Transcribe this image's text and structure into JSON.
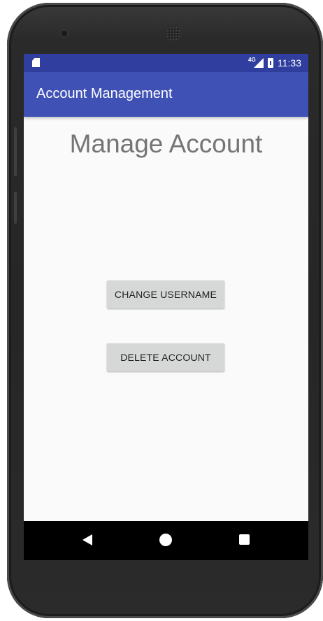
{
  "status_bar": {
    "network_label": "4G",
    "time": "11:33",
    "icons": [
      "sd-card-icon",
      "signal-icon",
      "battery-icon"
    ]
  },
  "app_bar": {
    "title": "Account Management"
  },
  "main": {
    "heading": "Manage Account",
    "buttons": {
      "change_username": "CHANGE USERNAME",
      "delete_account": "DELETE ACCOUNT"
    }
  },
  "nav_bar": {
    "icons": [
      "back-icon",
      "home-icon",
      "recent-apps-icon"
    ]
  },
  "colors": {
    "status_bar": "#303f9f",
    "app_bar": "#3f51b5",
    "background": "#fafafa",
    "button": "#d6d7d7",
    "heading_text": "#757575"
  }
}
